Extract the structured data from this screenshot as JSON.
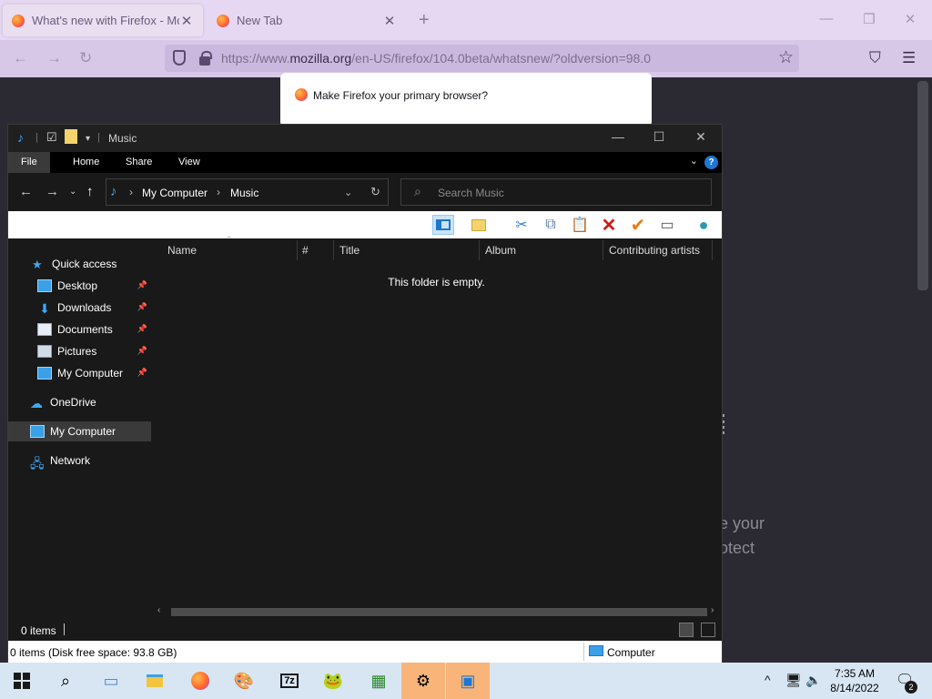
{
  "browser": {
    "tabs": [
      {
        "label": "What's new with Firefox - More"
      },
      {
        "label": "New Tab"
      }
    ],
    "url_prefix": "https://www.",
    "url_domain": "mozilla.org",
    "url_rest": "/en-US/firefox/104.0beta/whatsnew/?oldversion=98.0",
    "popup_title": "Make Firefox your primary browser?",
    "page_text_1": "e your",
    "page_text_2": "otect"
  },
  "explorer": {
    "title": "Music",
    "ribbon_tabs": [
      "File",
      "Home",
      "Share",
      "View"
    ],
    "breadcrumb": [
      "My Computer",
      "Music"
    ],
    "search_placeholder": "Search Music",
    "nav_items": [
      {
        "label": "Quick access",
        "icon": "star-icon"
      },
      {
        "label": "Desktop",
        "icon": "desktop-icon",
        "pinned": true
      },
      {
        "label": "Downloads",
        "icon": "download-icon",
        "pinned": true
      },
      {
        "label": "Documents",
        "icon": "document-icon",
        "pinned": true
      },
      {
        "label": "Pictures",
        "icon": "pictures-icon",
        "pinned": true
      },
      {
        "label": "My Computer",
        "icon": "computer-icon",
        "pinned": true
      },
      {
        "label": "OneDrive",
        "icon": "cloud-icon"
      },
      {
        "label": "My Computer",
        "icon": "computer-icon",
        "selected": true
      },
      {
        "label": "Network",
        "icon": "network-icon"
      }
    ],
    "columns": [
      "Name",
      "#",
      "Title",
      "Album",
      "Contributing artists"
    ],
    "empty_message": "This folder is empty.",
    "status_count": "0 items",
    "detail_info": "0 items (Disk free space: 93.8 GB)",
    "detail_location": "Computer"
  },
  "taskbar": {
    "time": "7:35 AM",
    "date": "8/14/2022",
    "notification_count": "2"
  },
  "colors": {
    "accent": "#1e77d3",
    "taskbar_active": "#f9b47a"
  }
}
